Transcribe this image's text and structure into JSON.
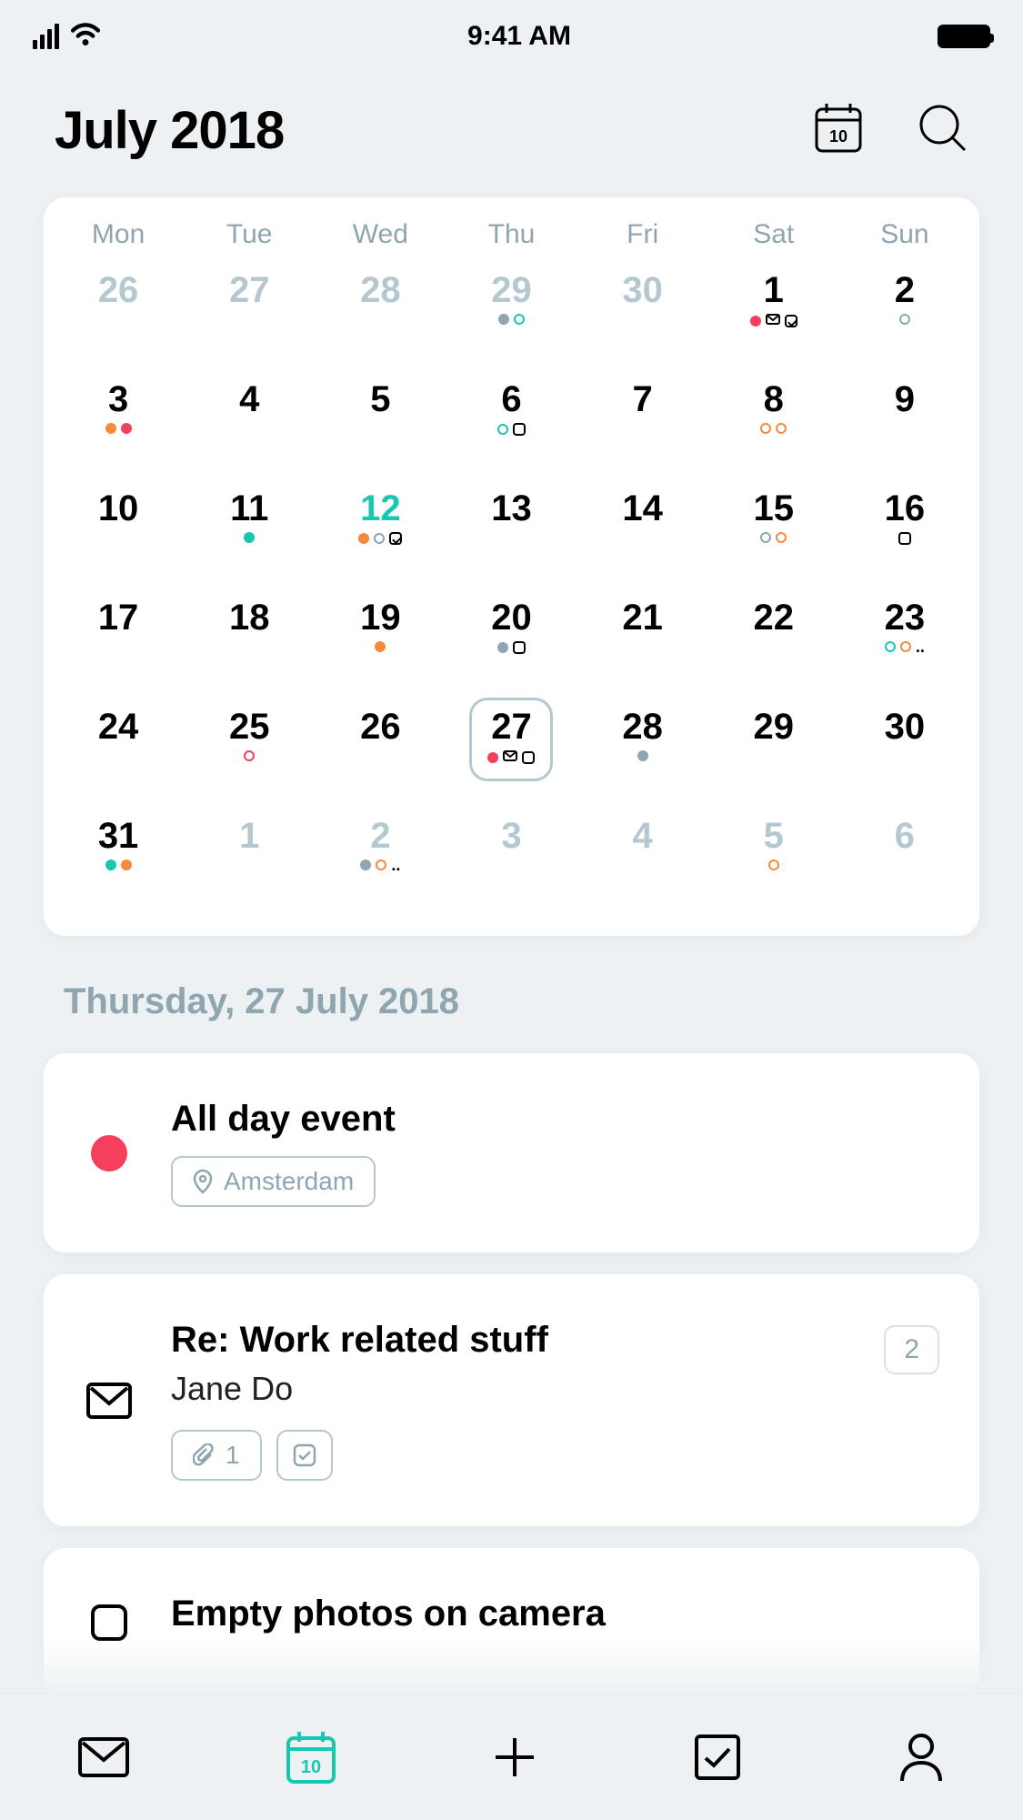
{
  "status": {
    "time": "9:41 AM"
  },
  "header": {
    "title": "July 2018"
  },
  "calendar": {
    "weekdays": [
      "Mon",
      "Tue",
      "Wed",
      "Thu",
      "Fri",
      "Sat",
      "Sun"
    ],
    "weeks": [
      [
        {
          "n": "26",
          "muted": true
        },
        {
          "n": "27",
          "muted": true
        },
        {
          "n": "28",
          "muted": true
        },
        {
          "n": "29",
          "muted": true,
          "dots": [
            {
              "t": "d",
              "c": "slate"
            },
            {
              "t": "dr",
              "c": "teal"
            }
          ]
        },
        {
          "n": "30",
          "muted": true
        },
        {
          "n": "1",
          "dots": [
            {
              "t": "d",
              "c": "red"
            },
            {
              "t": "env"
            },
            {
              "t": "sqc"
            }
          ]
        },
        {
          "n": "2",
          "dots": [
            {
              "t": "dr",
              "c": "slate"
            }
          ]
        }
      ],
      [
        {
          "n": "3",
          "dots": [
            {
              "t": "d",
              "c": "orange"
            },
            {
              "t": "d",
              "c": "red"
            }
          ]
        },
        {
          "n": "4"
        },
        {
          "n": "5"
        },
        {
          "n": "6",
          "dots": [
            {
              "t": "dr",
              "c": "teal"
            },
            {
              "t": "sq"
            }
          ]
        },
        {
          "n": "7"
        },
        {
          "n": "8",
          "dots": [
            {
              "t": "dr",
              "c": "orange"
            },
            {
              "t": "dr",
              "c": "orange"
            }
          ]
        },
        {
          "n": "9"
        }
      ],
      [
        {
          "n": "10"
        },
        {
          "n": "11",
          "dots": [
            {
              "t": "d",
              "c": "teal"
            }
          ]
        },
        {
          "n": "12",
          "teal": true,
          "dots": [
            {
              "t": "d",
              "c": "orange"
            },
            {
              "t": "dr",
              "c": "slate"
            },
            {
              "t": "sqc"
            }
          ]
        },
        {
          "n": "13"
        },
        {
          "n": "14"
        },
        {
          "n": "15",
          "dots": [
            {
              "t": "dr",
              "c": "slate"
            },
            {
              "t": "dr",
              "c": "orange"
            }
          ]
        },
        {
          "n": "16",
          "dots": [
            {
              "t": "sq"
            }
          ]
        }
      ],
      [
        {
          "n": "17"
        },
        {
          "n": "18"
        },
        {
          "n": "19",
          "dots": [
            {
              "t": "d",
              "c": "orange"
            }
          ]
        },
        {
          "n": "20",
          "dots": [
            {
              "t": "d",
              "c": "slate"
            },
            {
              "t": "sq"
            }
          ]
        },
        {
          "n": "21"
        },
        {
          "n": "22"
        },
        {
          "n": "23",
          "dots": [
            {
              "t": "dr",
              "c": "teal"
            },
            {
              "t": "dr",
              "c": "orange"
            },
            {
              "t": "ell"
            }
          ]
        }
      ],
      [
        {
          "n": "24"
        },
        {
          "n": "25",
          "dots": [
            {
              "t": "dr",
              "c": "red"
            }
          ]
        },
        {
          "n": "26"
        },
        {
          "n": "27",
          "selected": true,
          "dots": [
            {
              "t": "d",
              "c": "red"
            },
            {
              "t": "env"
            },
            {
              "t": "sq"
            }
          ]
        },
        {
          "n": "28",
          "dots": [
            {
              "t": "d",
              "c": "slate"
            }
          ]
        },
        {
          "n": "29"
        },
        {
          "n": "30"
        }
      ],
      [
        {
          "n": "31",
          "dots": [
            {
              "t": "d",
              "c": "teal"
            },
            {
              "t": "d",
              "c": "orange"
            }
          ]
        },
        {
          "n": "1",
          "muted": true
        },
        {
          "n": "2",
          "muted": true,
          "dots": [
            {
              "t": "d",
              "c": "slate"
            },
            {
              "t": "dr",
              "c": "orange"
            },
            {
              "t": "ell"
            }
          ]
        },
        {
          "n": "3",
          "muted": true
        },
        {
          "n": "4",
          "muted": true
        },
        {
          "n": "5",
          "muted": true,
          "dots": [
            {
              "t": "dr",
              "c": "orange"
            }
          ]
        },
        {
          "n": "6",
          "muted": true
        }
      ]
    ]
  },
  "dateHeading": "Thursday, 27 July 2018",
  "events": [
    {
      "type": "event",
      "title": "All day event",
      "location": "Amsterdam",
      "color": "#F63E5D"
    },
    {
      "type": "email",
      "title": "Re: Work related stuff",
      "sender": "Jane Do",
      "attachments": "1",
      "threadCount": "2"
    },
    {
      "type": "todo",
      "title": "Empty photos on camera"
    }
  ],
  "tabs": {
    "calendarBadge": "10"
  }
}
